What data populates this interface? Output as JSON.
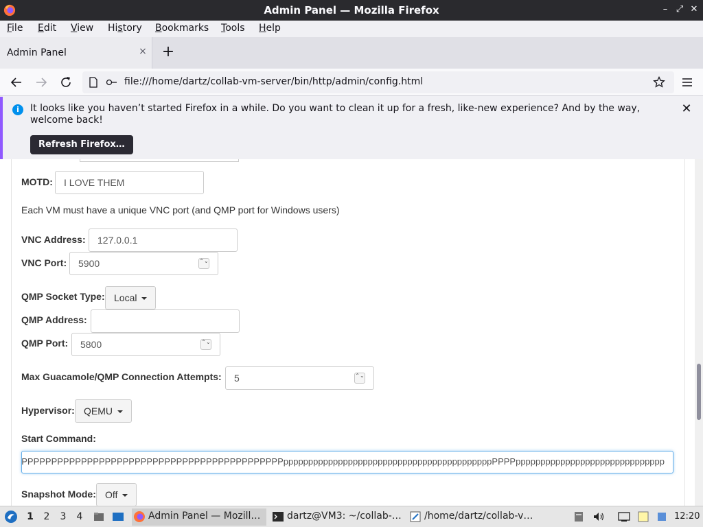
{
  "window": {
    "title": "Admin Panel — Mozilla Firefox",
    "controls": [
      "–",
      "⤢",
      "✕"
    ]
  },
  "menubar": {
    "items": [
      {
        "label": "File",
        "accel": "F",
        "rest": "ile"
      },
      {
        "label": "Edit",
        "accel": "E",
        "rest": "dit"
      },
      {
        "label": "View",
        "accel": "V",
        "rest": "iew"
      },
      {
        "label": "History",
        "accel": "S",
        "pre": "Hi",
        "rest": "tory"
      },
      {
        "label": "Bookmarks",
        "accel": "B",
        "rest": "ookmarks"
      },
      {
        "label": "Tools",
        "accel": "T",
        "rest": "ools"
      },
      {
        "label": "Help",
        "accel": "H",
        "rest": "elp"
      }
    ]
  },
  "tabs": [
    {
      "label": "Admin Panel",
      "close": "×"
    }
  ],
  "newtab": "+",
  "navbar": {
    "url": "file:///home/dartz/collab-vm-server/bin/http/admin/config.html"
  },
  "notification": {
    "message": "It looks like you haven’t started Firefox in a while. Do you want to clean it up for a fresh, like-new experience? And by the way, welcome back!",
    "button": "Refresh Firefox…",
    "close": "✕"
  },
  "form": {
    "motd_label": "MOTD:",
    "motd_value": "I LOVE THEM",
    "vnc_note": "Each VM must have a unique VNC port (and QMP port for Windows users)",
    "vnc_address_label": "VNC Address:",
    "vnc_address_value": "127.0.0.1",
    "vnc_port_label": "VNC Port:",
    "vnc_port_value": "5900",
    "qmp_socket_type_label": "QMP Socket Type:",
    "qmp_socket_type_value": "Local",
    "qmp_address_label": "QMP Address:",
    "qmp_address_value": "",
    "qmp_port_label": "QMP Port:",
    "qmp_port_value": "5800",
    "max_attempts_label": "Max Guacamole/QMP Connection Attempts:",
    "max_attempts_value": "5",
    "hypervisor_label": "Hypervisor:",
    "hypervisor_value": "QEMU",
    "start_command_label": "Start Command:",
    "start_command_value": "PPPPPPPPPPPPPPPPPPPPPPPPPPPPPPPPPPPPPPPPPPPPPPPPPPPPPPPPPPPPPPPPPppppppppppppppppppppppppppppppppppppppppppPPPPpppppppppppppppppppppppppppppp",
    "snapshot_mode_label": "Snapshot Mode:",
    "snapshot_mode_value": "Off",
    "spinner": "⌃⌄"
  },
  "taskbar": {
    "workspaces": [
      "1",
      "2",
      "3",
      "4"
    ],
    "tasks": [
      {
        "label": "Admin Panel — Mozill…",
        "icon": "firefox-icon"
      },
      {
        "label": "dartz@VM3: ~/collab-…",
        "icon": "terminal-icon"
      },
      {
        "label": "/home/dartz/collab-v…",
        "icon": "editor-icon"
      }
    ],
    "clock": "12:20"
  },
  "colors": {
    "accent": "#9059ff",
    "info": "#0090ed",
    "focus": "#66afe9",
    "titlebar": "#2a2a2e"
  }
}
